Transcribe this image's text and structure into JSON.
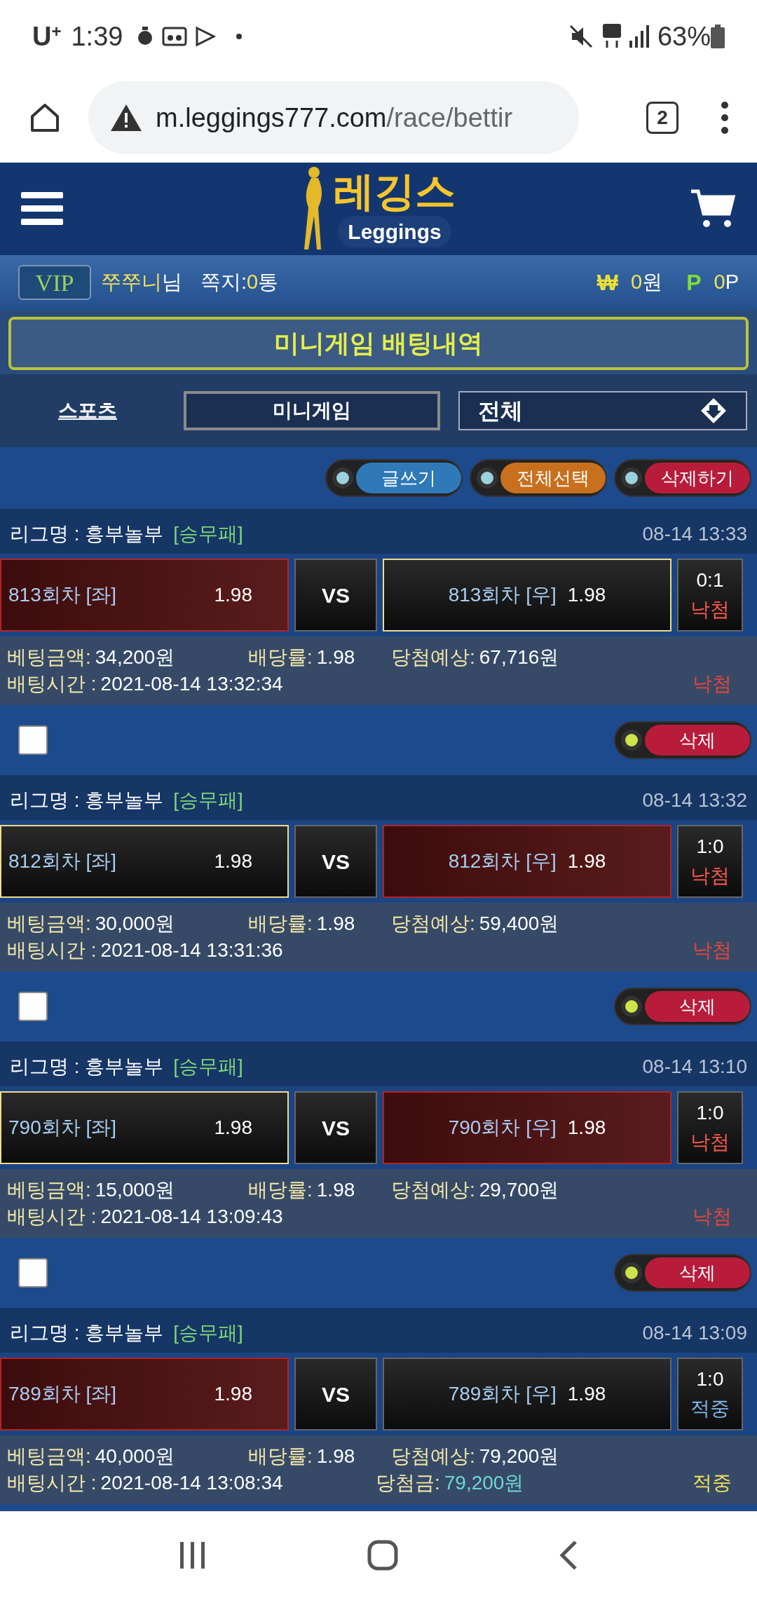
{
  "status_bar": {
    "carrier": "U",
    "carrier_mark": "+",
    "time": "1:39",
    "battery": "63%"
  },
  "browser": {
    "url_host": "m.leggings777.com",
    "url_path": "/race/bettir",
    "tab_count": "2"
  },
  "header": {
    "logo_title": "레깅스",
    "logo_subtitle": "Leggings"
  },
  "user_bar": {
    "badge": "VIP",
    "nickname": "쭈쭈니",
    "honorific": "님",
    "messages_label": "쪽지:",
    "messages_count": "0",
    "messages_unit": "통",
    "currency_sign": "₩",
    "money": "0",
    "money_unit": "원",
    "points_sign": "P",
    "points": "0",
    "points_unit": "P"
  },
  "page_title": "미니게임 배팅내역",
  "tabs": [
    {
      "label": "스포츠",
      "selected": false
    },
    {
      "label": "미니게임",
      "selected": true
    }
  ],
  "filter": {
    "value": "전체"
  },
  "actions": [
    {
      "label": "글쓰기",
      "color": "#2f79b8"
    },
    {
      "label": "전체선택",
      "color": "#c8701e"
    },
    {
      "label": "삭제하기",
      "color": "#b81c3a"
    }
  ],
  "bets": [
    {
      "league": "리그명 : 흥부놀부",
      "market": "[승무패]",
      "time": "08-14 13:33",
      "left": {
        "label": "813회차 [좌]",
        "odds": "1.98",
        "picked": true,
        "outlined": false
      },
      "vs": "VS",
      "right": {
        "label": "813회차 [우]",
        "odds": "1.98",
        "picked": false,
        "outlined": true
      },
      "score": "0:1",
      "result": "낙첨",
      "won": false,
      "amount_label": "베팅금액:",
      "amount": "34,200원",
      "rate_label": "배당률:",
      "rate": "1.98",
      "expected_label": "당첨예상:",
      "expected": "67,716원",
      "time_label": "배팅시간 :",
      "bet_time": "2021-08-14 13:32:34",
      "status": "낙첨"
    },
    {
      "checkbox": {
        "checked": false,
        "delete_label": "삭제"
      },
      "league": "리그명 : 흥부놀부",
      "market": "[승무패]",
      "time": "08-14 13:32",
      "left": {
        "label": "812회차 [좌]",
        "odds": "1.98",
        "picked": false,
        "outlined": true
      },
      "vs": "VS",
      "right": {
        "label": "812회차 [우]",
        "odds": "1.98",
        "picked": true,
        "outlined": false
      },
      "score": "1:0",
      "result": "낙첨",
      "won": false,
      "amount_label": "베팅금액:",
      "amount": "30,000원",
      "rate_label": "배당률:",
      "rate": "1.98",
      "expected_label": "당첨예상:",
      "expected": "59,400원",
      "time_label": "배팅시간 :",
      "bet_time": "2021-08-14 13:31:36",
      "status": "낙첨"
    },
    {
      "checkbox": {
        "checked": false,
        "delete_label": "삭제"
      },
      "league": "리그명 : 흥부놀부",
      "market": "[승무패]",
      "time": "08-14 13:10",
      "left": {
        "label": "790회차 [좌]",
        "odds": "1.98",
        "picked": false,
        "outlined": true
      },
      "vs": "VS",
      "right": {
        "label": "790회차 [우]",
        "odds": "1.98",
        "picked": true,
        "outlined": false
      },
      "score": "1:0",
      "result": "낙첨",
      "won": false,
      "amount_label": "베팅금액:",
      "amount": "15,000원",
      "rate_label": "배당률:",
      "rate": "1.98",
      "expected_label": "당첨예상:",
      "expected": "29,700원",
      "time_label": "배팅시간 :",
      "bet_time": "2021-08-14 13:09:43",
      "status": "낙첨"
    },
    {
      "checkbox": {
        "checked": false,
        "delete_label": "삭제"
      },
      "league": "리그명 : 흥부놀부",
      "market": "[승무패]",
      "time": "08-14 13:09",
      "left": {
        "label": "789회차 [좌]",
        "odds": "1.98",
        "picked": true,
        "outlined": false
      },
      "vs": "VS",
      "right": {
        "label": "789회차 [우]",
        "odds": "1.98",
        "picked": false,
        "outlined": false
      },
      "score": "1:0",
      "result": "적중",
      "won": true,
      "amount_label": "베팅금액:",
      "amount": "40,000원",
      "rate_label": "배당률:",
      "rate": "1.98",
      "expected_label": "당첨예상:",
      "expected": "79,200원",
      "time_label": "배팅시간 :",
      "bet_time": "2021-08-14 13:08:34",
      "winnings_label": "당첨금:",
      "winnings": "79,200원",
      "status": "적중"
    }
  ]
}
